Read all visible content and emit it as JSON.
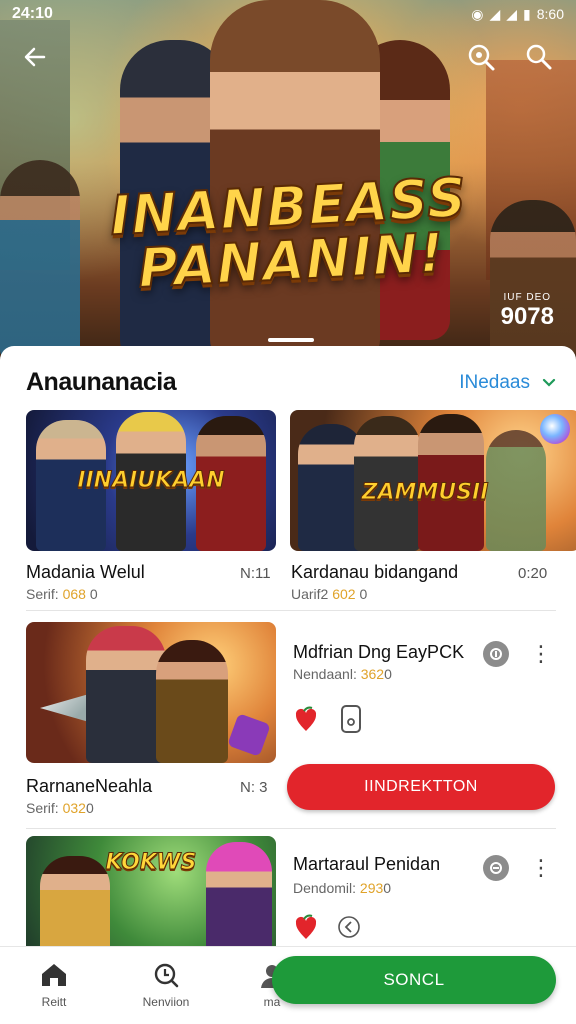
{
  "status_bar": {
    "time": "24:10",
    "battery": "8:60"
  },
  "hero": {
    "title_line1": "INANBEASS",
    "title_line2": "PANANIN!",
    "badge_label": "IUF DEO",
    "badge_value": "9078",
    "back_icon": "arrow-left-icon",
    "search_icons": [
      "search-icon",
      "search-icon"
    ]
  },
  "section": {
    "title": "Anaunanacia",
    "link": "INedaas",
    "link_icon": "chevron-down-icon"
  },
  "cards": [
    {
      "cover_text": "IINAIUKAAN",
      "title": "Madania Welul",
      "meta_prefix": "Serif: ",
      "meta_value": "068",
      "meta_suffix": "0",
      "duration": "N:11"
    },
    {
      "cover_text": "ZAMMUSII",
      "title": "Kardanau bidangand",
      "meta_prefix": "Uarif2 ",
      "meta_value": "602",
      "meta_suffix": "0",
      "duration": "0:20"
    },
    {
      "title": "RarnaneNeahla",
      "meta_prefix": "Serif: ",
      "meta_value": "032",
      "meta_suffix": "0",
      "duration": "N: 3"
    },
    {
      "cover_text": "KOKWS"
    }
  ],
  "side_items": [
    {
      "title": "Mdfrian Dng EayPCK",
      "meta_prefix": "Nendaanl: ",
      "meta_value": "362",
      "meta_suffix": "0"
    },
    {
      "title": "Martaraul Penidan",
      "meta_prefix": "Dendomil: ",
      "meta_value": "293",
      "meta_suffix": "0"
    }
  ],
  "buttons": {
    "red": "IINDREKTTON",
    "green": "SONCL"
  },
  "nav": [
    {
      "label": "Reitt",
      "icon": "home-icon"
    },
    {
      "label": "Nenviion",
      "icon": "clock-icon"
    },
    {
      "label": "ma",
      "icon": "profile-icon"
    }
  ],
  "colors": {
    "accent_blue": "#2a8bd8",
    "red": "#e2252b",
    "green": "#1e9a3a",
    "gold": "#e0a32a"
  }
}
